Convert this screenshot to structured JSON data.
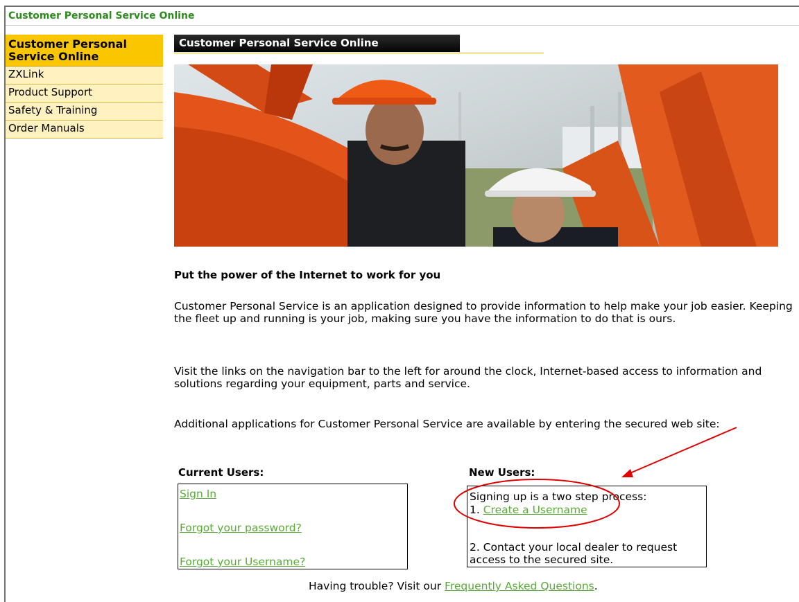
{
  "app": {
    "title": "Customer Personal Service Online"
  },
  "sidebar": {
    "items": [
      {
        "label": "Customer Personal Service Online"
      },
      {
        "label": "ZXLink"
      },
      {
        "label": "Product Support"
      },
      {
        "label": "Safety & Training"
      },
      {
        "label": "Order Manuals"
      }
    ]
  },
  "banner": {
    "title": "Customer Personal Service Online"
  },
  "content": {
    "headline": "Put the power of the Internet to work for you",
    "p1": "Customer Personal Service is an application designed to provide information to help make your job easier. Keeping the fleet up and running is your job, making sure you have the information to do that is ours.",
    "p2": "Visit the links on the navigation bar to the left for around the clock, Internet-based access to information and solutions regarding your equipment, parts and service.",
    "p3": "Additional applications for Customer Personal Service are available by entering the secured web site:"
  },
  "current_users": {
    "title": "Current Users:",
    "sign_in": "Sign In",
    "forgot_password": "Forgot your password?",
    "forgot_username": "Forgot your Username?"
  },
  "new_users": {
    "title": "New Users:",
    "intro": "Signing up is a two step process:",
    "step1_prefix": "1.",
    "step1_link": "Create a Username",
    "step2": "2. Contact your local dealer to request access to the secured site."
  },
  "footer": {
    "prefix": "Having trouble?  Visit our",
    "faq_link": "Frequently Asked Questions",
    "suffix": "."
  },
  "colors": {
    "brand_green": "#2e8b1e",
    "link_green": "#5aaa3a",
    "nav_active": "#f9c600",
    "nav_bg": "#fff2c0",
    "annotation_red": "#e00000"
  }
}
